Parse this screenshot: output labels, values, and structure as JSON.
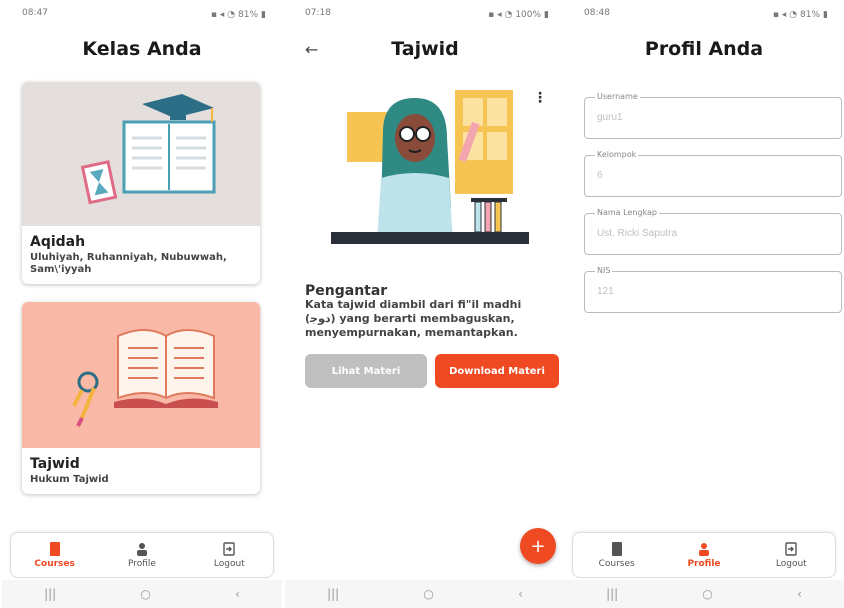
{
  "screens": [
    {
      "status": {
        "time": "08:47",
        "battery": "81%"
      },
      "title": "Kelas Anda",
      "courses": [
        {
          "title": "Aqidah",
          "subtitle": "Uluhiyah, Ruhanniyah, Nubuwwah, Sam\\'iyyah",
          "bg": "#e4dedc"
        },
        {
          "title": "Tajwid",
          "subtitle": "Hukum Tajwid",
          "bg": "#f9b9a6"
        }
      ],
      "nav": {
        "courses": "Courses",
        "profile": "Profile",
        "logout": "Logout",
        "active": "courses"
      }
    },
    {
      "status": {
        "time": "07:18",
        "battery": "100%"
      },
      "title": "Tajwid",
      "section_title": "Pengantar",
      "section_text": "Kata tajwid diambil dari fi\"il madhi (ﺩﻮﺟ) yang berarti membaguskan, menyempurnakan, memantapkan.",
      "buttons": {
        "view": "Lihat Materi",
        "download": "Download Materi"
      },
      "fab": "+"
    },
    {
      "status": {
        "time": "08:48",
        "battery": "81%"
      },
      "title": "Profil Anda",
      "fields": [
        {
          "label": "Username",
          "value": "guru1"
        },
        {
          "label": "Kelompok",
          "value": "6"
        },
        {
          "label": "Nama Lengkap",
          "value": "Ust. Ricki Saputra"
        },
        {
          "label": "NIS",
          "value": "121"
        }
      ],
      "nav": {
        "courses": "Courses",
        "profile": "Profile",
        "logout": "Logout",
        "active": "profile"
      }
    }
  ],
  "colors": {
    "accent": "#f04a23",
    "gray_button": "#bfbfbf"
  },
  "icons": [
    "back-arrow-icon",
    "more-vert-icon",
    "book-icon",
    "person-icon",
    "logout-icon",
    "add-icon"
  ]
}
